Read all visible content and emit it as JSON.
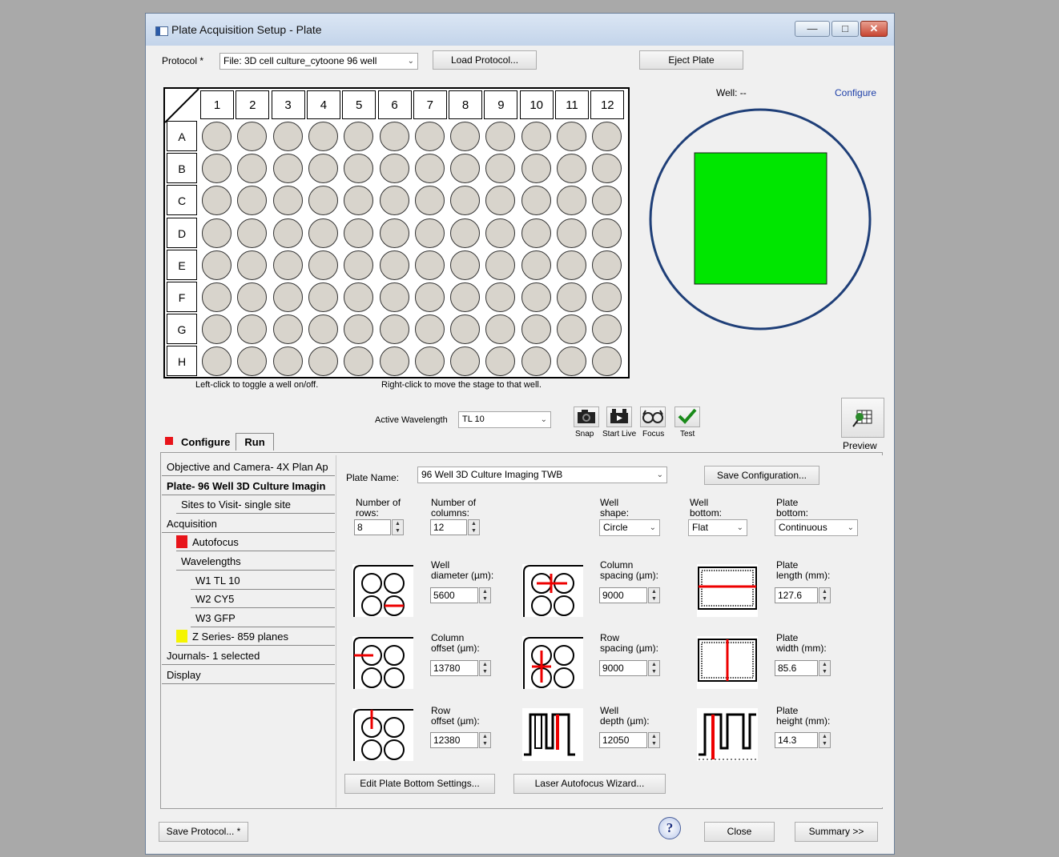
{
  "window": {
    "title": "Plate Acquisition Setup - Plate"
  },
  "protocol": {
    "label": "Protocol *",
    "value": "File: 3D cell culture_cytoone 96 well",
    "load_label": "Load Protocol...",
    "eject_label": "Eject Plate"
  },
  "plate_map": {
    "columns": [
      "1",
      "2",
      "3",
      "4",
      "5",
      "6",
      "7",
      "8",
      "9",
      "10",
      "11",
      "12"
    ],
    "rows": [
      "A",
      "B",
      "C",
      "D",
      "E",
      "F",
      "G",
      "H"
    ],
    "hint_left": "Left-click to toggle a well on/off.",
    "hint_right": "Right-click to move the stage to that well."
  },
  "well_view": {
    "label": "Well: --",
    "configure_label": "Configure",
    "site_color": "#00e600",
    "ring_color": "#1f3f78"
  },
  "wavelength": {
    "label": "Active Wavelength",
    "value": "TL 10"
  },
  "tools": [
    {
      "label": "Snap",
      "icon": "camera-icon"
    },
    {
      "label": "Start Live",
      "icon": "video-camera-icon"
    },
    {
      "label": "Focus",
      "icon": "glasses-icon"
    },
    {
      "label": "Test",
      "icon": "checkmark-icon"
    }
  ],
  "preview": {
    "label": "Preview"
  },
  "tabs": {
    "configure": "Configure",
    "run": "Run"
  },
  "tree": [
    {
      "label": "Objective and Camera- 4X Plan Ap",
      "indent": 0,
      "bold": false,
      "swatch": null
    },
    {
      "label": "Plate- 96 Well 3D Culture Imagin",
      "indent": 0,
      "bold": true,
      "swatch": null
    },
    {
      "label": "Sites to Visit- single site",
      "indent": 1,
      "bold": false,
      "swatch": null
    },
    {
      "label": "Acquisition",
      "indent": 0,
      "bold": false,
      "swatch": null
    },
    {
      "label": "Autofocus",
      "indent": 1,
      "bold": false,
      "swatch": "#e8141a"
    },
    {
      "label": "Wavelengths",
      "indent": 1,
      "bold": false,
      "swatch": null
    },
    {
      "label": "W1 TL 10",
      "indent": 2,
      "bold": false,
      "swatch": null
    },
    {
      "label": "W2 CY5",
      "indent": 2,
      "bold": false,
      "swatch": null
    },
    {
      "label": "W3 GFP",
      "indent": 2,
      "bold": false,
      "swatch": null
    },
    {
      "label": "Z Series- 859 planes",
      "indent": 1,
      "bold": false,
      "swatch": "#f5f500"
    },
    {
      "label": "Journals- 1 selected",
      "indent": 0,
      "bold": false,
      "swatch": null
    },
    {
      "label": "Display",
      "indent": 0,
      "bold": false,
      "swatch": null
    }
  ],
  "plate_settings": {
    "name_label": "Plate Name:",
    "name_value": "96 Well 3D Culture Imaging TWB",
    "save_config_label": "Save Configuration...",
    "rows": {
      "label1": "Number of",
      "label2": "rows:",
      "value": "8"
    },
    "columns": {
      "label1": "Number of",
      "label2": "columns:",
      "value": "12"
    },
    "well_shape": {
      "label1": "Well",
      "label2": "shape:",
      "value": "Circle"
    },
    "well_bottom": {
      "label1": "Well",
      "label2": "bottom:",
      "value": "Flat"
    },
    "plate_bottom": {
      "label1": "Plate",
      "label2": "bottom:",
      "value": "Continuous"
    },
    "well_diameter": {
      "label1": "Well",
      "label2": "diameter (µm):",
      "value": "5600"
    },
    "column_spacing": {
      "label1": "Column",
      "label2": "spacing (µm):",
      "value": "9000"
    },
    "plate_length": {
      "label1": "Plate",
      "label2": "length (mm):",
      "value": "127.6"
    },
    "column_offset": {
      "label1": "Column",
      "label2": "offset (µm):",
      "value": "13780"
    },
    "row_spacing": {
      "label1": "Row",
      "label2": "spacing (µm):",
      "value": "9000"
    },
    "plate_width": {
      "label1": "Plate",
      "label2": "width (mm):",
      "value": "85.6"
    },
    "row_offset": {
      "label1": "Row",
      "label2": "offset (µm):",
      "value": "12380"
    },
    "well_depth": {
      "label1": "Well",
      "label2": "depth (µm):",
      "value": "12050"
    },
    "plate_height": {
      "label1": "Plate",
      "label2": "height (mm):",
      "value": "14.3"
    },
    "edit_bottom_label": "Edit Plate Bottom Settings...",
    "laser_af_label": "Laser Autofocus Wizard..."
  },
  "footer": {
    "save_protocol_label": "Save Protocol... *",
    "help_glyph": "?",
    "close_label": "Close",
    "summary_label": "Summary >>"
  }
}
